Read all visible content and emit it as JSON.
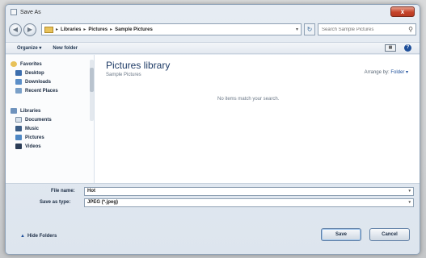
{
  "window": {
    "title": "Save As",
    "close_label": "x"
  },
  "address": {
    "crumbs": [
      "Libraries",
      "Pictures",
      "Sample Pictures"
    ],
    "search_placeholder": "Search Sample Pictures"
  },
  "toolbar": {
    "organize_label": "Organize ▾",
    "new_folder_label": "New folder"
  },
  "sidebar": {
    "favorites": {
      "label": "Favorites",
      "items": [
        "Desktop",
        "Downloads",
        "Recent Places"
      ]
    },
    "libraries": {
      "label": "Libraries",
      "items": [
        "Documents",
        "Music",
        "Pictures",
        "Videos"
      ]
    }
  },
  "content": {
    "title": "Pictures library",
    "subtitle": "Sample Pictures",
    "arrange_label": "Arrange by:",
    "arrange_value": "Folder ▾",
    "empty_message": "No items match your search."
  },
  "fields": {
    "file_name_label": "File name:",
    "file_name_value": "Hot",
    "save_type_label": "Save as type:",
    "save_type_value": "JPEG (*.jpeg)"
  },
  "footer": {
    "hide_folders_label": "Hide Folders",
    "save_label": "Save",
    "cancel_label": "Cancel"
  },
  "colors": {
    "accent": "#1e4f9a",
    "close": "#c5432a",
    "folder": "#e8c25a"
  }
}
